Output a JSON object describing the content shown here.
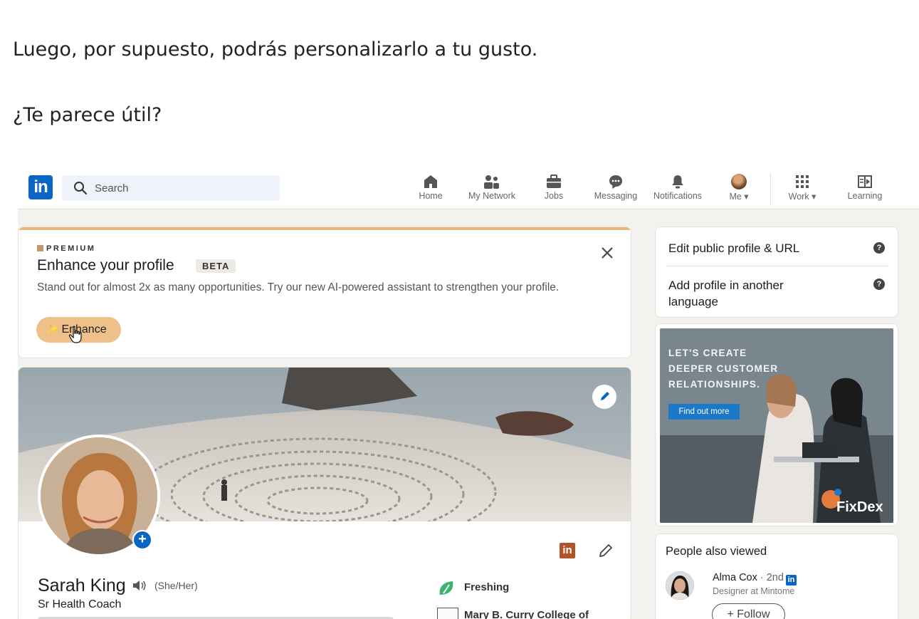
{
  "intro": {
    "line1": "Luego, por supuesto, podrás personalizarlo a tu gusto.",
    "line2": "¿Te parece útil?"
  },
  "topnav": {
    "logo_text": "in",
    "search_placeholder": "Search",
    "items": [
      {
        "label": "Home",
        "icon": "home-icon"
      },
      {
        "label": "My Network",
        "icon": "network-icon"
      },
      {
        "label": "Jobs",
        "icon": "briefcase-icon"
      },
      {
        "label": "Messaging",
        "icon": "chat-icon"
      },
      {
        "label": "Notifications",
        "icon": "bell-icon"
      },
      {
        "label": "Me ▾",
        "icon": "avatar"
      },
      {
        "label": "Work ▾",
        "icon": "grid-icon"
      },
      {
        "label": "Learning",
        "icon": "learning-icon"
      }
    ]
  },
  "premium": {
    "tag": "PREMIUM",
    "title": "Enhance your profile",
    "badge": "BETA",
    "description": "Stand out for almost 2x as many opportunities. Try our new AI-powered assistant to strengthen your profile.",
    "button_label": "Enhance",
    "accent": "#e8b879",
    "button_color": "#f0c08a"
  },
  "profile": {
    "name": "Sarah King",
    "pronouns": "(She/Her)",
    "headline": "Sr Health Coach",
    "company": "Freshing",
    "school": "Mary B. Curry College of",
    "li_badge": "in"
  },
  "sidebar": {
    "links": [
      {
        "label": "Edit public  profile & URL",
        "help": "?"
      },
      {
        "label": "Add profile in another language",
        "help": "?"
      }
    ]
  },
  "ad": {
    "headline": [
      "LET'S CREATE",
      "DEEPER CUSTOMER",
      "RELATIONSHIPS."
    ],
    "cta": "Find out more",
    "brand": "FixDex"
  },
  "people_also_viewed": {
    "title": "People also viewed",
    "people": [
      {
        "name": "Alma Cox",
        "degree": "· 2nd",
        "li": "in",
        "subtitle": "Designer at Mintome",
        "action": "+ Follow"
      }
    ]
  },
  "colors": {
    "brand_blue": "#0a66c2",
    "background": "#f3f2ef"
  }
}
